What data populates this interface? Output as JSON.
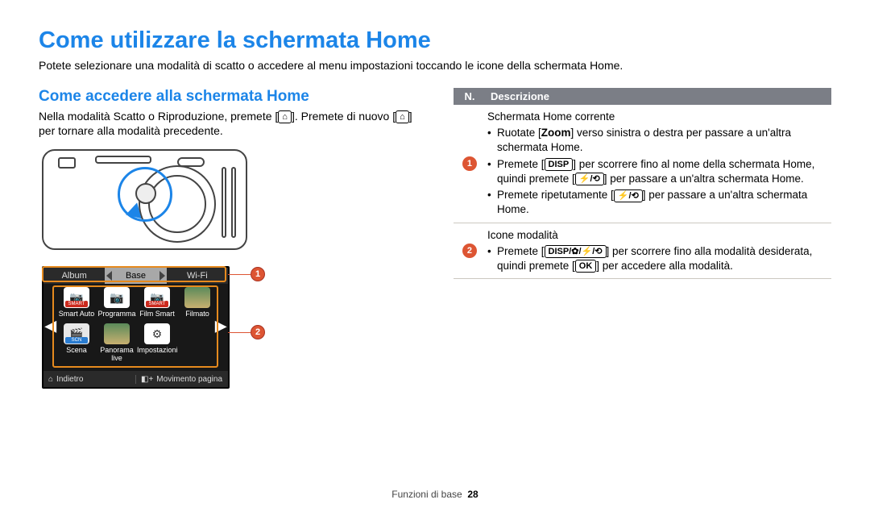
{
  "title": "Come utilizzare la schermata Home",
  "intro": "Potete selezionare una modalità di scatto o accedere al menu impostazioni toccando le icone della schermata Home.",
  "section_title": "Come accedere alla schermata Home",
  "body_pre": "Nella modalità Scatto o Riproduzione, premete [",
  "body_mid": "]. Premete di nuovo [",
  "body_post": "] per tornare alla modalità precedente.",
  "screen": {
    "tabs": {
      "left": "Album",
      "center": "Base",
      "right": "Wi-Fi"
    },
    "modes_row1": [
      "Smart Auto",
      "Programma",
      "Film Smart",
      "Filmato"
    ],
    "modes_row2": [
      "Scena",
      "Panorama live",
      "Impostazioni"
    ],
    "footer_left": "Indietro",
    "footer_right": "Movimento pagina"
  },
  "callouts": {
    "c1": "1",
    "c2": "2"
  },
  "table": {
    "header_n": "N.",
    "header_desc": "Descrizione",
    "row1": {
      "num": "1",
      "title": "Schermata Home corrente",
      "b1_pre": "Ruotate [",
      "b1_zoom": "Zoom",
      "b1_post": "] verso sinistra o destra per passare a un'altra schermata Home.",
      "b2_pre": "Premete [",
      "b2_mid": "] per scorrere fino al nome della schermata Home, quindi premete [",
      "b2_post": "] per passare a un'altra schermata Home.",
      "b3_pre": "Premete ripetutamente [",
      "b3_post": "] per passare a un'altra schermata Home."
    },
    "row2": {
      "num": "2",
      "title": "Icone modalità",
      "b1_pre": "Premete [",
      "b1_mid": "] per scorrere fino alla modalità desiderata, quindi premete [",
      "b1_post": "] per accedere alla modalità."
    }
  },
  "pagefoot": {
    "section": "Funzioni di base",
    "page": "28"
  }
}
